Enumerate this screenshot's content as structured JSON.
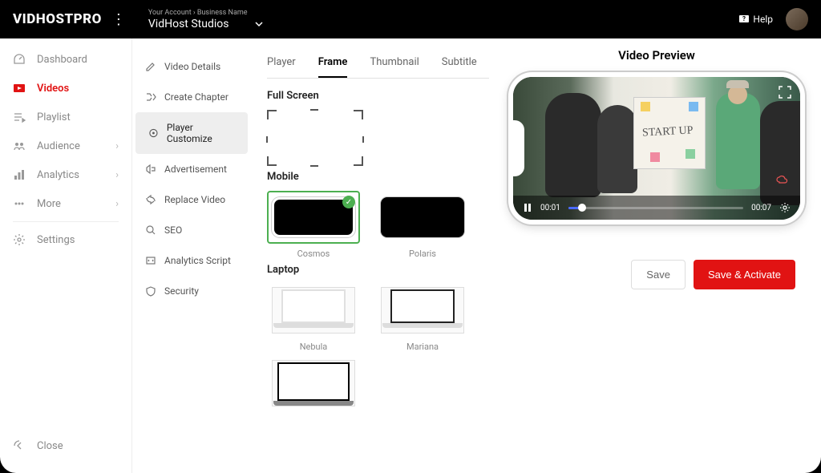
{
  "topbar": {
    "logo": "VIDHOSTPRO",
    "breadcrumb": "Your Account › Business Name",
    "business": "VidHost Studios",
    "help": "Help"
  },
  "sidebar1": {
    "items": [
      {
        "label": "Dashboard"
      },
      {
        "label": "Videos"
      },
      {
        "label": "Playlist"
      },
      {
        "label": "Audience"
      },
      {
        "label": "Analytics"
      },
      {
        "label": "More"
      },
      {
        "label": "Settings"
      }
    ],
    "close": "Close"
  },
  "sidebar2": {
    "items": [
      {
        "label": "Video Details"
      },
      {
        "label": "Create Chapter"
      },
      {
        "label": "Player Customize"
      },
      {
        "label": "Advertisement"
      },
      {
        "label": "Replace Video"
      },
      {
        "label": "SEO"
      },
      {
        "label": "Analytics Script"
      },
      {
        "label": "Security"
      }
    ]
  },
  "tabs": [
    "Player",
    "Frame",
    "Thumbnail",
    "Subtitle"
  ],
  "sections": {
    "fullscreen": "Full Screen",
    "mobile": "Mobile",
    "laptop": "Laptop"
  },
  "frames": {
    "mobile": [
      {
        "label": "Cosmos"
      },
      {
        "label": "Polaris"
      }
    ],
    "laptop": [
      {
        "label": "Nebula"
      },
      {
        "label": "Mariana"
      }
    ]
  },
  "preview": {
    "title": "Video Preview",
    "boardText": "START UP",
    "time_current": "00:01",
    "time_total": "00:07"
  },
  "actions": {
    "save": "Save",
    "activate": "Save & Activate"
  }
}
